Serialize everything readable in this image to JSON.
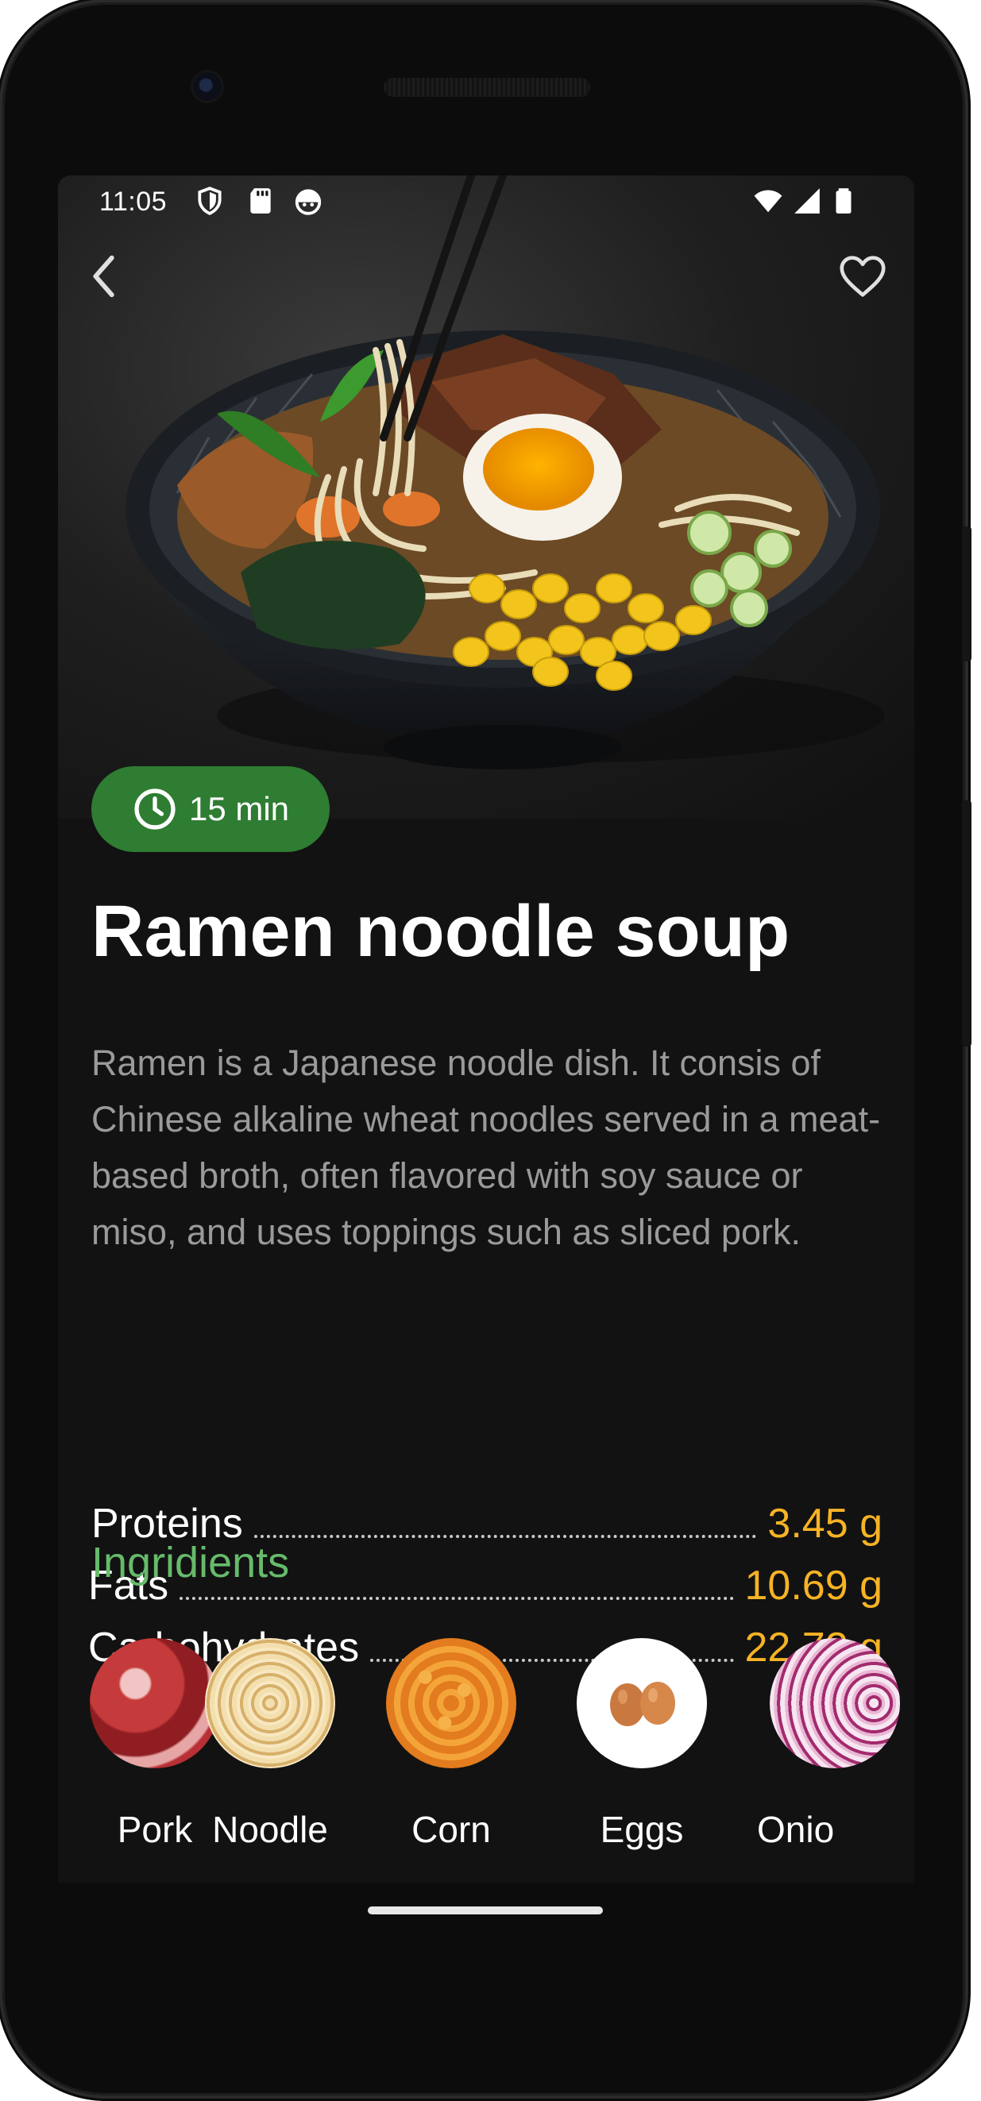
{
  "status_bar": {
    "time": "11:05",
    "left_icons": [
      "shield-icon",
      "sd-card-icon",
      "android-face-icon"
    ],
    "right_icons": [
      "wifi-icon",
      "signal-icon",
      "battery-icon"
    ]
  },
  "hero": {
    "image": "ramen-bowl-photo",
    "back_icon": "chevron-left-icon",
    "favorite_icon": "heart-outline-icon"
  },
  "recipe": {
    "cook_time": "15 min",
    "title": "Ramen noodle soup",
    "description": "Ramen is a Japanese noodle dish. It consis of Chinese alkaline wheat noodles served in a meat-based broth, often flavored with soy sauce or miso, and uses toppings such as sliced pork."
  },
  "nutrition": [
    {
      "label": "Proteins",
      "value": "3.45 g"
    },
    {
      "label": "Fats",
      "value": "10.69 g"
    },
    {
      "label": "Carbohydrates",
      "value": "22.72 g"
    }
  ],
  "ingredients_section": {
    "title": "Ingridients",
    "items": [
      {
        "name": "Pork"
      },
      {
        "name": "Noodle"
      },
      {
        "name": "Corn"
      },
      {
        "name": "Eggs"
      },
      {
        "name": "Onio"
      }
    ]
  },
  "colors": {
    "background": "#121212",
    "accent_green": "#2e7d32",
    "section_green": "#66bb6a",
    "value_yellow": "#f6b324",
    "description_gray": "#9a9a9a"
  }
}
